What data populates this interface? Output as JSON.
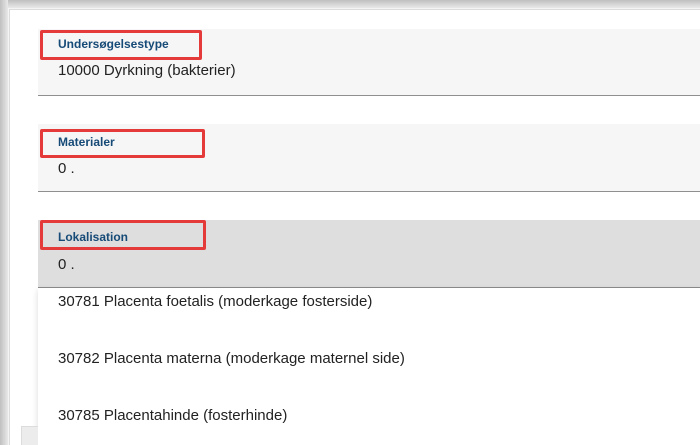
{
  "fields": [
    {
      "label": "Undersøgelsestype",
      "value": "10000 Dyrkning (bakterier)"
    },
    {
      "label": "Materialer",
      "value": "0 ."
    },
    {
      "label": "Lokalisation",
      "value": "0 ."
    }
  ],
  "dropdown": {
    "options": [
      {
        "label": "30781 Placenta foetalis (moderkage fosterside)"
      },
      {
        "label": "30782 Placenta materna (moderkage maternel side)"
      },
      {
        "label": "30785 Placentahinde (fosterhinde)"
      }
    ]
  },
  "highlight_color": "#e53a3a",
  "label_color": "#164a77"
}
